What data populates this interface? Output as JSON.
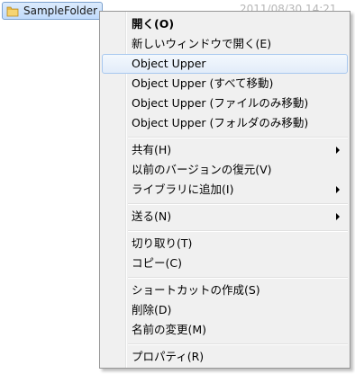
{
  "explorer": {
    "selected_item": "SampleFolder",
    "date_partial": "2011/08/30 14:21"
  },
  "context_menu": {
    "items": [
      {
        "label": "開く(O)"
      },
      {
        "label": "新しいウィンドウで開く(E)"
      },
      {
        "label": "Object Upper"
      },
      {
        "label": "Object Upper (すべて移動)"
      },
      {
        "label": "Object Upper (ファイルのみ移動)"
      },
      {
        "label": "Object Upper (フォルダのみ移動)"
      },
      {
        "label": "共有(H)"
      },
      {
        "label": "以前のバージョンの復元(V)"
      },
      {
        "label": "ライブラリに追加(I)"
      },
      {
        "label": "送る(N)"
      },
      {
        "label": "切り取り(T)"
      },
      {
        "label": "コピー(C)"
      },
      {
        "label": "ショートカットの作成(S)"
      },
      {
        "label": "削除(D)"
      },
      {
        "label": "名前の変更(M)"
      },
      {
        "label": "プロパティ(R)"
      }
    ]
  },
  "colors": {
    "hover_border": "#a8c8ef",
    "menu_background": "#f0f0f0",
    "selection_background": "#c1dbfc"
  }
}
